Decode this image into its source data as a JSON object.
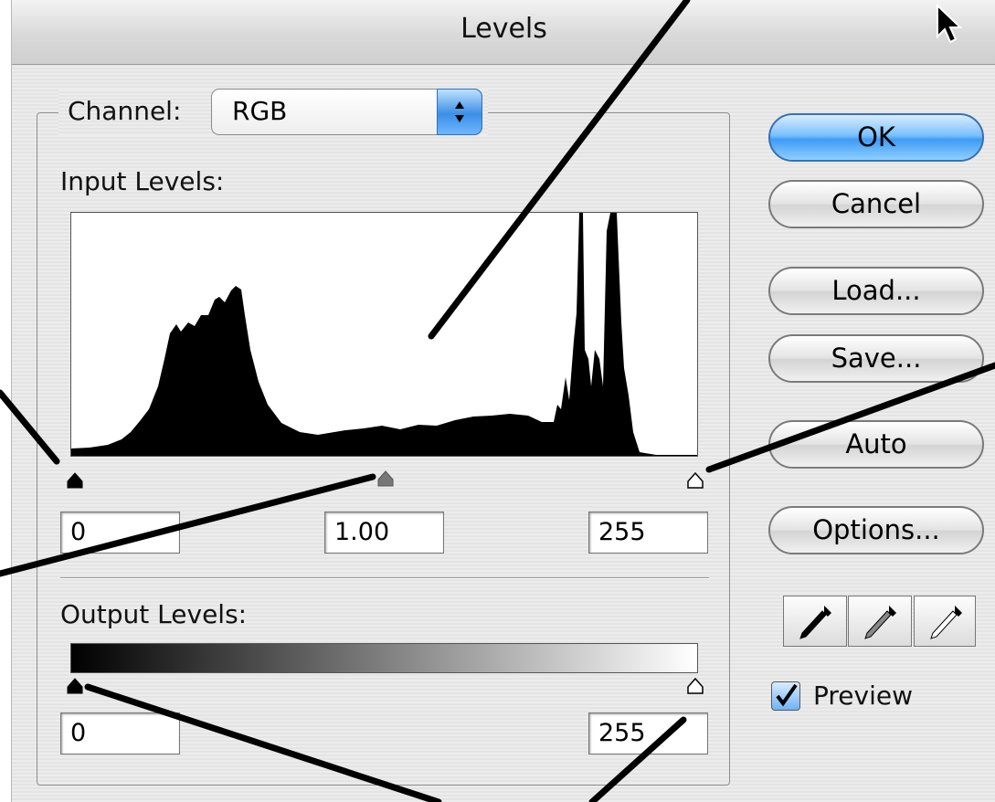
{
  "window": {
    "title": "Levels"
  },
  "channel": {
    "label": "Channel:",
    "value": "RGB"
  },
  "input_levels": {
    "label": "Input Levels:",
    "shadow": "0",
    "gamma": "1.00",
    "highlight": "255"
  },
  "output_levels": {
    "label": "Output Levels:",
    "shadow": "0",
    "highlight": "255"
  },
  "buttons": {
    "ok": "OK",
    "cancel": "Cancel",
    "load": "Load...",
    "save": "Save...",
    "auto": "Auto",
    "options": "Options..."
  },
  "preview": {
    "label": "Preview",
    "checked": true
  },
  "icons": [
    "black-eyedropper-icon",
    "gray-eyedropper-icon",
    "white-eyedropper-icon"
  ],
  "colors": {
    "accent": "#3f9bf5",
    "histogram": "#000000"
  }
}
